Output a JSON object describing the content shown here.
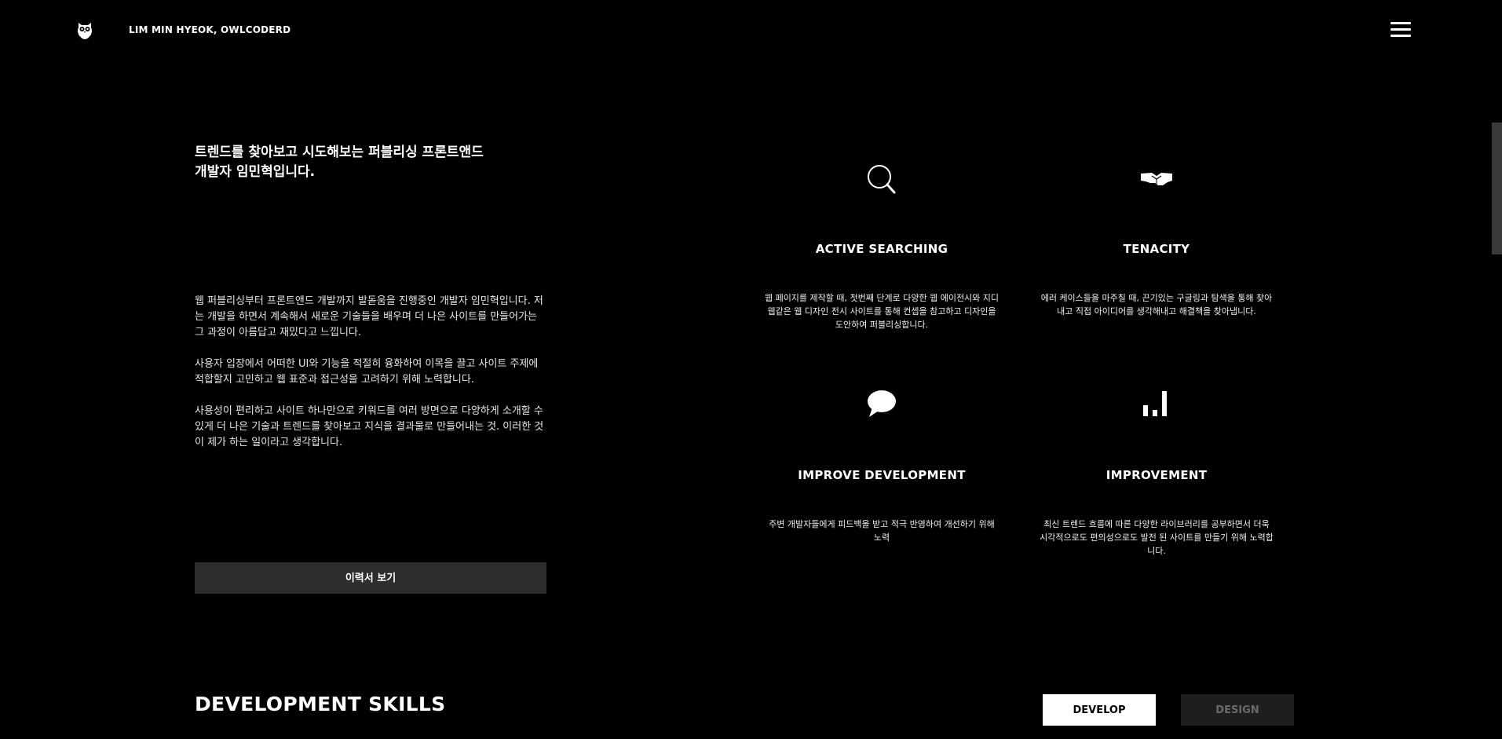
{
  "header": {
    "site_name": "LIM MIN HYEOK, OWLCODERD"
  },
  "intro": {
    "title_line1": "트렌드를 찾아보고 시도해보는 퍼블리싱 프론트앤드",
    "title_line2": "개발자 임민혁입니다.",
    "paragraphs": [
      "웹 퍼블리싱부터 프론트앤드 개발까지 발돋움을 진행중인 개발자 임민혁입니다. 저는 개발을 하면서 계속해서 새로운 기술들을 배우며 더 나은 사이트를 만들어가는 그 과정이 아름답고 재밌다고 느낍니다.",
      "사용자 입장에서 어떠한 UI와 기능을 적절히 융화하여 이목을 끌고 사이트 주제에 적합할지 고민하고 웹 표준과 접근성을 고려하기 위해 노력합니다.",
      "사용성이 편리하고 사이트 하나만으로 키워드를 여러 방면으로 다양하게 소개할 수 있게 더 나은 기술과 트렌드를 찾아보고 지식을 결과물로 만들어내는 것. 이러한 것이 제가 하는 일이라고 생각합니다."
    ],
    "resume_button": "이력서 보기"
  },
  "features": [
    {
      "icon": "search-icon",
      "title": "ACTIVE SEARCHING",
      "desc": "웹 페이지를 제작할 때, 첫번째 단계로 다양한 웹 에이전시와 지디웹같은 웹 디자인 전시 사이트를 통해 컨셉을 참고하고 디자인을 도안하여 퍼블리싱합니다."
    },
    {
      "icon": "handshake-icon",
      "title": "TENACITY",
      "desc": "에러 케이스들을 마주칠 때, 끈기있는 구글링과 탐색을 통해 찾아내고 직접 아이디어를 생각해내고 해결책을 찾아냅니다."
    },
    {
      "icon": "speech-bubble-icon",
      "title": "IMPROVE DEVELOPMENT",
      "desc": "주변 개발자들에게 피드백을 받고 적극 반영하여 개선하기 위해 노력"
    },
    {
      "icon": "bar-chart-icon",
      "title": "IMPROVEMENT",
      "desc": "최신 트렌드 흐름에 따른 다양한 라이브러리를 공부하면서 더욱 시각적으로도 편의성으로도 발전 된 사이트를 만들기 위해 노력합니다."
    }
  ],
  "skills": {
    "title": "DEVELOPMENT SKILLS",
    "tab_develop": "DEVELOP",
    "tab_design": "DESIGN"
  }
}
